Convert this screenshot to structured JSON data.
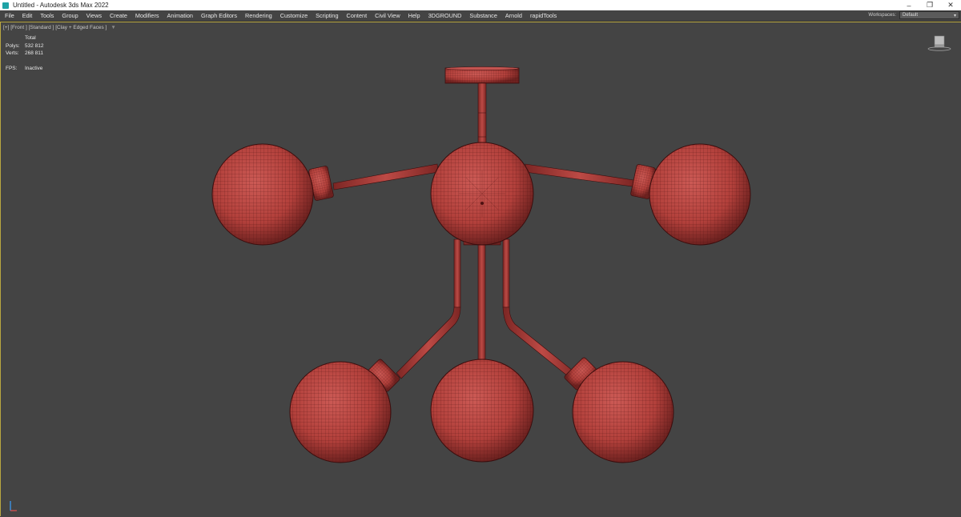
{
  "window": {
    "title": "Untitled - Autodesk 3ds Max 2022",
    "controls": {
      "minimize": "–",
      "restore": "❐",
      "close": "✕"
    }
  },
  "menu": {
    "items": [
      "File",
      "Edit",
      "Tools",
      "Group",
      "Views",
      "Create",
      "Modifiers",
      "Animation",
      "Graph Editors",
      "Rendering",
      "Customize",
      "Scripting",
      "Content",
      "Civil View",
      "Help",
      "3DGROUND",
      "Substance",
      "Arnold",
      "rapidTools"
    ]
  },
  "workspaces": {
    "label": "Workspaces:",
    "value": "Default"
  },
  "viewport": {
    "label": "[+] [Front ] [Standard ] [Clay + Edged Faces ]",
    "filter_icon": "funnel-icon",
    "stats": {
      "header": "Total",
      "polys_label": "Polys:",
      "polys_value": "532 812",
      "verts_label": "Verts:",
      "verts_value": "268 811",
      "fps_label": "FPS:",
      "fps_value": "Inactive"
    }
  },
  "colors": {
    "model": "#b8413c",
    "wire": "#5a1414",
    "viewport_bg": "#444444",
    "active_border": "#b9a640"
  }
}
